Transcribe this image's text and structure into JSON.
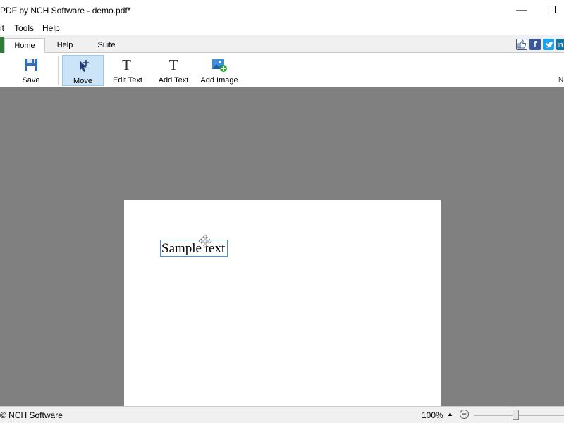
{
  "window": {
    "title": "PDF by NCH Software - demo.pdf*",
    "minimize_glyph": "—",
    "close_glyph": "✕"
  },
  "menu": {
    "items": [
      {
        "label": "it",
        "underline": ""
      },
      {
        "label": "ools",
        "underline": "T"
      },
      {
        "label": "elp",
        "underline": "H"
      }
    ]
  },
  "tabs": {
    "items": [
      {
        "label": "Home",
        "active": true
      },
      {
        "label": "Help",
        "active": false
      },
      {
        "label": "Suite",
        "active": false
      }
    ]
  },
  "social": {
    "facebook_glyph": "f",
    "linkedin_glyph": "in",
    "colors": {
      "like": "#3b5998",
      "facebook": "#3b5998",
      "twitter": "#1da1f2",
      "linkedin": "#0e76a8"
    }
  },
  "toolbar": {
    "save_label": "Save",
    "move_label": "Move",
    "edit_text_label": "Edit Text",
    "edit_text_icon": "T",
    "add_text_label": "Add Text",
    "add_text_icon": "T",
    "add_image_label": "Add Image",
    "tail_label": "N"
  },
  "document": {
    "text": "Sample text"
  },
  "status": {
    "left_text": "© NCH Software",
    "zoom": "100%",
    "zoom_arrow": "▲",
    "zoom_out_glyph": "−",
    "zoom_slider_percent": 50
  },
  "colors": {
    "workspace": "#808080",
    "selection_border": "#4a90d9",
    "active_button_bg": "#cce4f7"
  }
}
